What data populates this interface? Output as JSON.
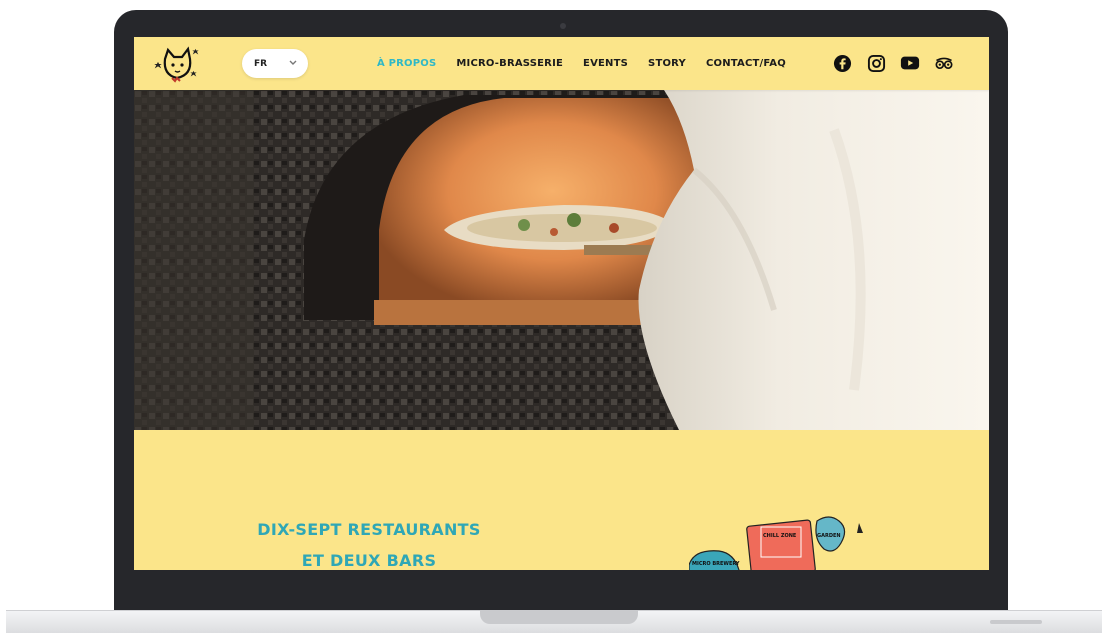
{
  "lang_selector": {
    "value": "FR"
  },
  "nav": {
    "items": [
      {
        "label": "À PROPOS",
        "active": true
      },
      {
        "label": "MICRO-BRASSERIE",
        "active": false
      },
      {
        "label": "EVENTS",
        "active": false
      },
      {
        "label": "STORY",
        "active": false
      },
      {
        "label": "CONTACT/FAQ",
        "active": false
      }
    ]
  },
  "socials": [
    "facebook-icon",
    "instagram-icon",
    "youtube-icon",
    "tripadvisor-icon"
  ],
  "hero": {
    "image": "pizza-oven-video"
  },
  "section": {
    "headline_line1": "DIX-SEPT RESTAURANTS",
    "headline_line2": "ET DEUX BARS",
    "illustration_labels": [
      "CHILL ZONE",
      "GARDEN",
      "MICRO BREWERY"
    ]
  },
  "colors": {
    "brand_yellow": "#fbe58a",
    "accent_teal": "#2fa7b6",
    "active_nav": "#2fb8c6"
  }
}
